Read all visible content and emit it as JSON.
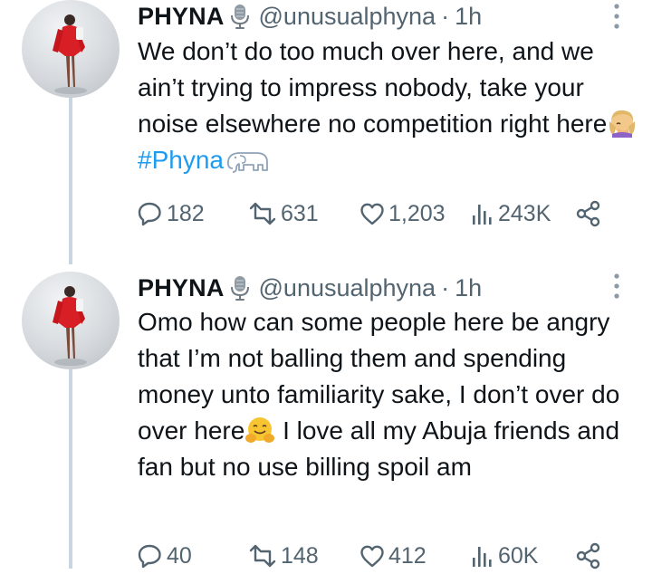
{
  "tweets": [
    {
      "author_name": "PHYNA",
      "handle": "@unusualphyna",
      "separator": "·",
      "time": "1h",
      "text_1": "We don’t do too much over here, and we ain’t trying to impress nobody, take your noise elsewhere no competition right here",
      "hashtag": "#Phyna",
      "emojis": [
        "microphone-emoji",
        "facepalm-emoji",
        "elephant-emoji"
      ],
      "stats": {
        "replies": "182",
        "retweets": "631",
        "likes": "1,203",
        "views": "243K"
      }
    },
    {
      "author_name": "PHYNA",
      "handle": "@unusualphyna",
      "separator": "·",
      "time": "1h",
      "text_1": "Omo how can some people here be angry that I’m not balling them and spending money unto familiarity sake, I don’t over do over here",
      "text_2": " I love all my Abuja friends and fan but no use billing spoil am",
      "emojis": [
        "microphone-emoji",
        "hugging-face-emoji"
      ],
      "stats": {
        "replies": "40",
        "retweets": "148",
        "likes": "412",
        "views": "60K"
      }
    }
  ],
  "colors": {
    "text": "#0f1419",
    "muted": "#536471",
    "link": "#1d9bf0",
    "thread_line": "#c9d6e1"
  }
}
